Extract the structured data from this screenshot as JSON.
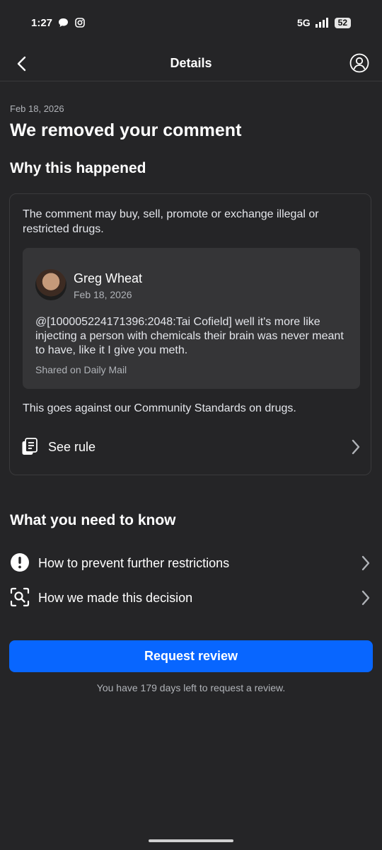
{
  "status_bar": {
    "time": "1:27",
    "network": "5G",
    "battery": "52"
  },
  "header": {
    "title": "Details"
  },
  "notice": {
    "date": "Feb 18, 2026",
    "title": "We removed your comment"
  },
  "why": {
    "heading": "Why this happened",
    "reason": "The comment may buy, sell, promote or exchange illegal or restricted drugs.",
    "comment": {
      "author": "Greg Wheat",
      "date": "Feb 18, 2026",
      "text": "@[100005224171396:2048:Tai Cofield] well it's more like injecting a person with chemicals their brain was never meant to have, like it I give you meth.",
      "source": "Shared on Daily Mail"
    },
    "standards": "This goes against our Community Standards on drugs.",
    "see_rule": "See rule"
  },
  "know": {
    "heading": "What you need to know",
    "items": [
      {
        "label": "How to prevent further restrictions",
        "icon": "exclamation-circle-icon"
      },
      {
        "label": "How we made this decision",
        "icon": "scan-search-icon"
      }
    ]
  },
  "review": {
    "button": "Request review",
    "note": "You have 179 days left to request a review."
  },
  "colors": {
    "background": "#252527",
    "accent": "#0866ff",
    "card": "#353537"
  }
}
